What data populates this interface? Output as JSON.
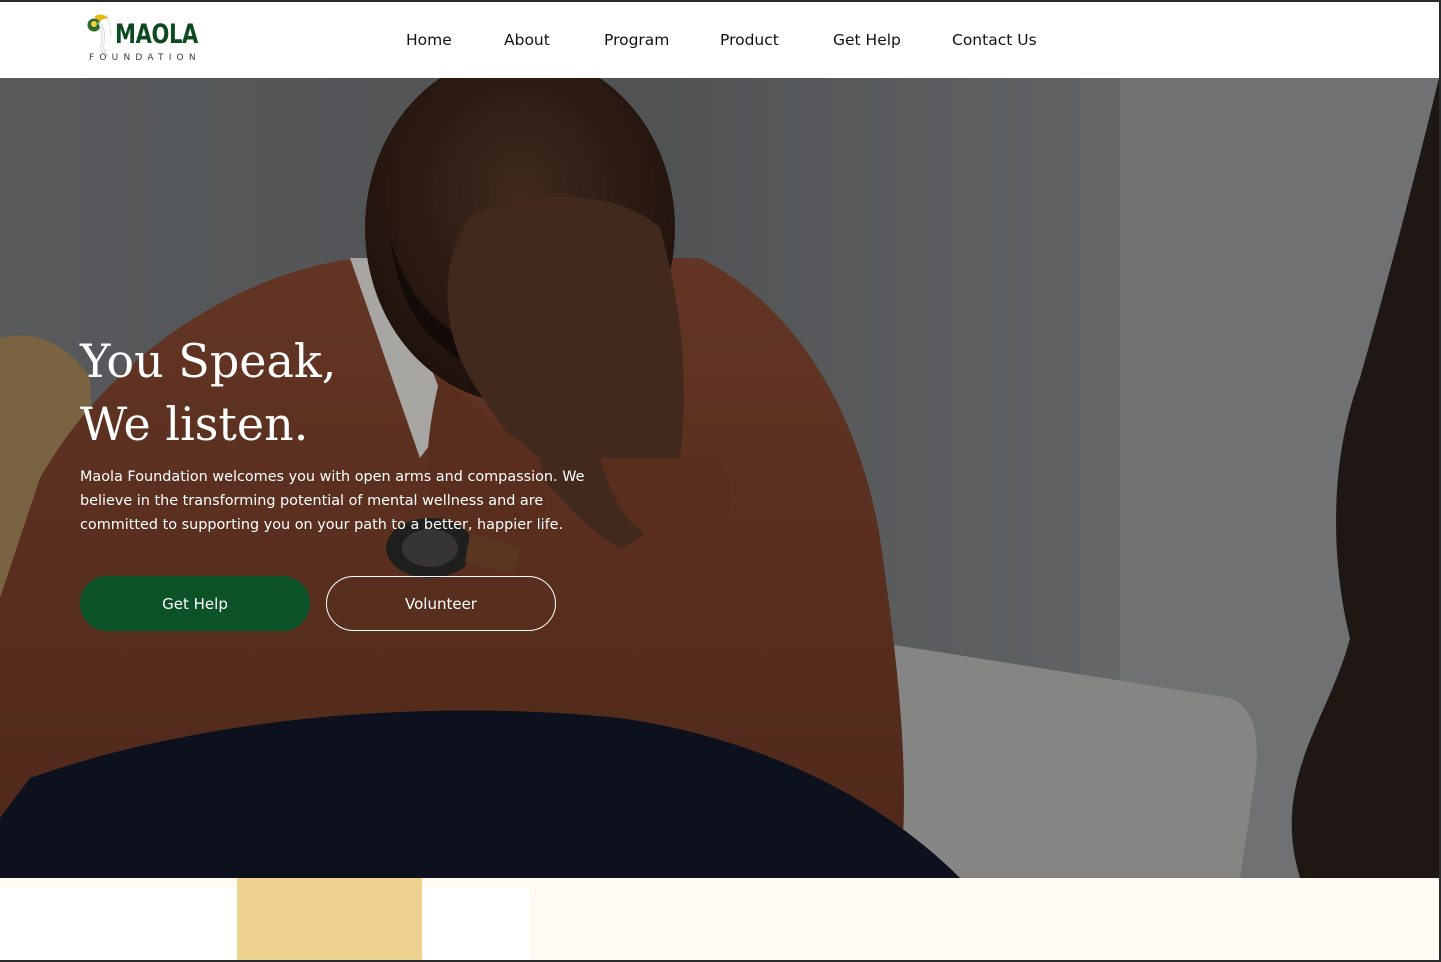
{
  "brand": {
    "name": "MAOLA",
    "tagline": "FOUNDATION",
    "color": "#0d4a1f"
  },
  "nav": {
    "items": [
      {
        "label": "Home"
      },
      {
        "label": "About"
      },
      {
        "label": "Program"
      },
      {
        "label": "Product"
      },
      {
        "label": "Get Help"
      },
      {
        "label": "Contact Us"
      }
    ]
  },
  "hero": {
    "headline_line1": "You Speak,",
    "headline_line2": "We listen.",
    "description": "Maola Foundation welcomes you with open arms and compassion. We believe in the transforming potential of mental wellness and are committed to supporting you on your path to a better, happier life.",
    "primary_button": "Get Help",
    "secondary_button": "Volunteer",
    "image_alt": "Man in a brown sweater covering his face with his hands during a counselling session",
    "primary_color": "#0b5228"
  },
  "colors": {
    "accent_gold": "#edd38f",
    "cream": "#fffaf2"
  }
}
